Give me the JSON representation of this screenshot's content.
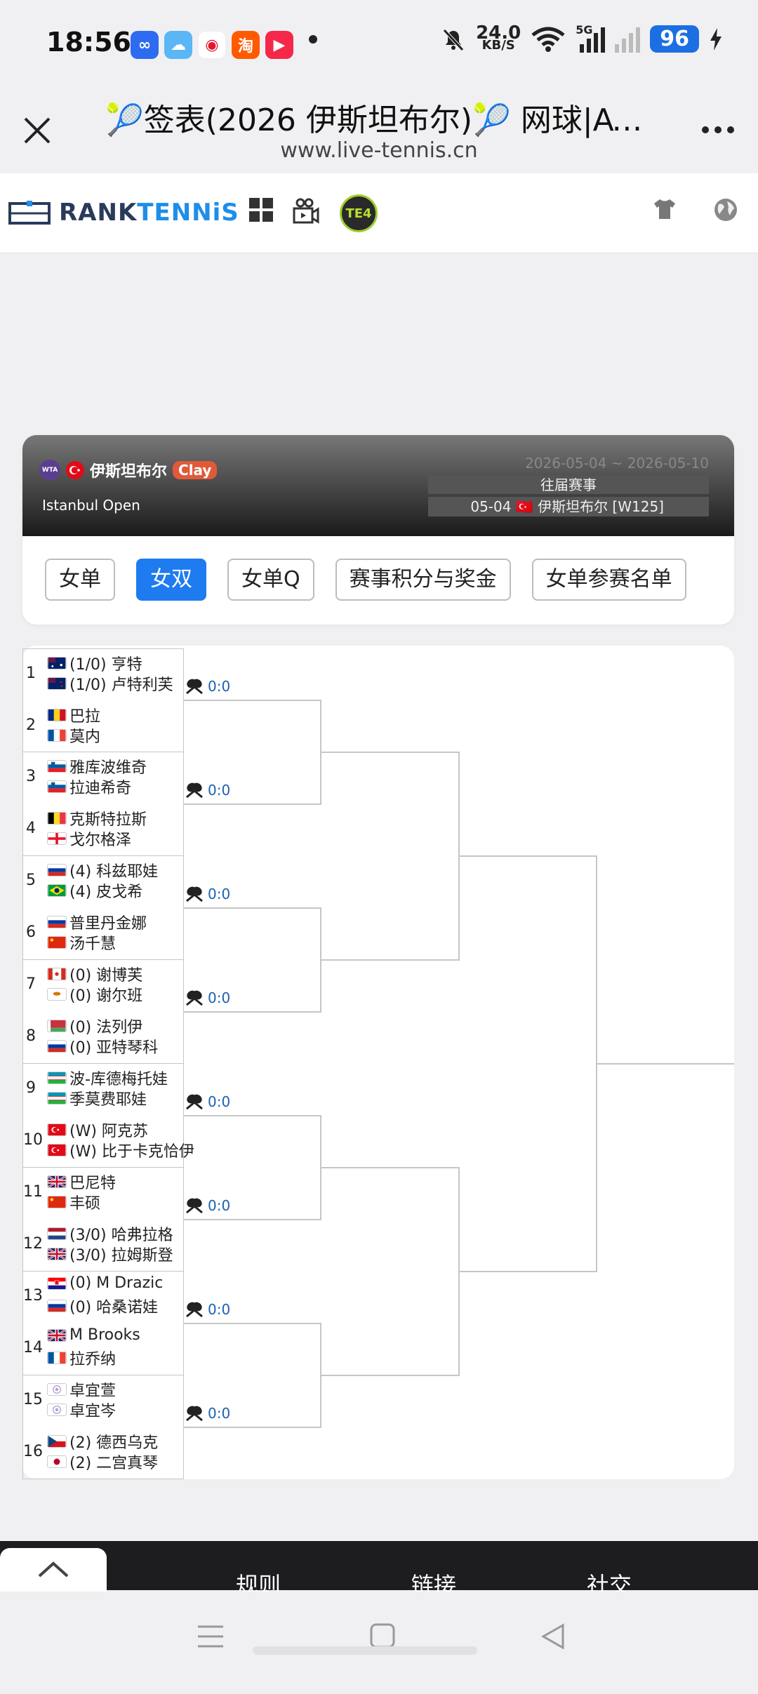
{
  "status_bar": {
    "time": "18:56",
    "net_speed_value": "24.0",
    "net_speed_unit": "KB/S",
    "network": "5G",
    "battery": "96",
    "app_icons": [
      "cloud-app-icon",
      "weather-icon",
      "weibo-icon",
      "taobao-icon",
      "video-app-icon"
    ],
    "taobao_glyph": "淘"
  },
  "browser": {
    "title": "🎾签表(2026 伊斯坦布尔)🎾 网球|AT...",
    "url": "www.live-tennis.cn"
  },
  "site": {
    "logo_part1": "RANK",
    "logo_part2": "TENN",
    "logo_part3": "iS",
    "te4": "TE4"
  },
  "tournament": {
    "name": "伊斯坦布尔",
    "surface": "Clay",
    "english_name": "Istanbul Open",
    "dates": "2026-05-04 ~ 2026-05-10",
    "past_label": "往届赛事",
    "past_item": "05-04 🇹🇷 伊斯坦布尔 [W125]",
    "wta": "WTA"
  },
  "tabs": [
    {
      "label": "女单"
    },
    {
      "label": "女双"
    },
    {
      "label": "女单Q"
    },
    {
      "label": "赛事积分与奖金"
    },
    {
      "label": "女单参赛名单"
    }
  ],
  "draw": {
    "teams": [
      {
        "seed": "1",
        "p1": "(1/0) 亨特",
        "p2": "(1/0) 卢特利芙",
        "f1": "aus",
        "f2": "nzl"
      },
      {
        "seed": "2",
        "p1": "巴拉",
        "p2": "莫内",
        "f1": "rou",
        "f2": "fra"
      },
      {
        "seed": "3",
        "p1": "雅库波维奇",
        "p2": "拉迪希奇",
        "f1": "svn",
        "f2": "svn"
      },
      {
        "seed": "4",
        "p1": "克斯特拉斯",
        "p2": "戈尔格泽",
        "f1": "bel",
        "f2": "geo"
      },
      {
        "seed": "5",
        "p1": "(4) 科兹耶娃",
        "p2": "(4) 皮戈希",
        "f1": "rus",
        "f2": "bra"
      },
      {
        "seed": "6",
        "p1": "普里丹金娜",
        "p2": "汤千慧",
        "f1": "rus",
        "f2": "chn"
      },
      {
        "seed": "7",
        "p1": "(0) 谢博芙",
        "p2": "(0) 谢尔班",
        "f1": "can",
        "f2": "cyp"
      },
      {
        "seed": "8",
        "p1": "(0) 法列伊",
        "p2": "(0) 亚特琴科",
        "f1": "blr",
        "f2": "rus"
      },
      {
        "seed": "9",
        "p1": "波-库德梅托娃",
        "p2": "季莫费耶娃",
        "f1": "uzb",
        "f2": "uzb"
      },
      {
        "seed": "10",
        "p1": "(W) 阿克苏",
        "p2": "(W) 比于卡克恰伊",
        "f1": "tur",
        "f2": "tur"
      },
      {
        "seed": "11",
        "p1": "巴尼特",
        "p2": "丰硕",
        "f1": "gbr",
        "f2": "chn"
      },
      {
        "seed": "12",
        "p1": "(3/0) 哈弗拉格",
        "p2": "(3/0) 拉姆斯登",
        "f1": "ned",
        "f2": "gbr"
      },
      {
        "seed": "13",
        "p1": "(0) M Drazic",
        "p2": "(0) 哈桑诺娃",
        "f1": "cro",
        "f2": "rus"
      },
      {
        "seed": "14",
        "p1": "M Brooks",
        "p2": "拉乔纳",
        "f1": "gbr",
        "f2": "fra"
      },
      {
        "seed": "15",
        "p1": "卓宜萱",
        "p2": "卓宜岑",
        "f1": "tpe",
        "f2": "tpe"
      },
      {
        "seed": "16",
        "p1": "(2) 德西乌克",
        "p2": "(2) 二宫真琴",
        "f1": "cze",
        "f2": "jpn"
      }
    ],
    "scores": [
      "0:0",
      "0:0",
      "0:0",
      "0:0",
      "0:0",
      "0:0",
      "0:0",
      "0:0"
    ]
  },
  "footer": {
    "links": [
      "规则",
      "链接",
      "社交"
    ]
  }
}
